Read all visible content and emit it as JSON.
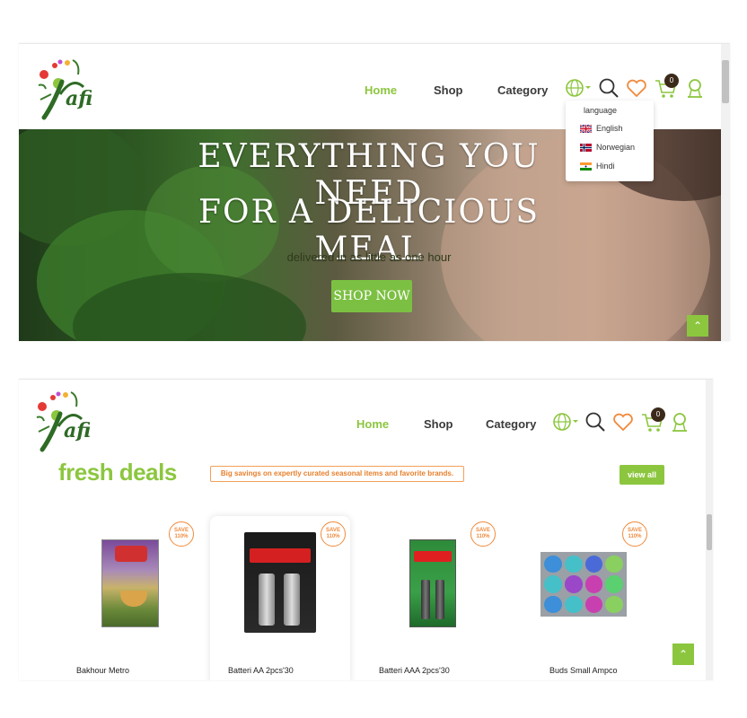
{
  "header": {
    "nav": [
      "Home",
      "Shop",
      "Category"
    ],
    "cart_count": "0"
  },
  "hero": {
    "title_line1": "EVERYTHING YOU NEED",
    "title_line2": "FOR A DELICIOUS MEAL",
    "subtitle": "delivered in as little as one hour",
    "cta": "SHOP NOW"
  },
  "language_menu": {
    "heading": "language",
    "options": [
      "English",
      "Norwegian",
      "Hindi"
    ]
  },
  "deals": {
    "title": "fresh deals",
    "tagline": "Big savings on expertly curated seasonal items and favorite brands.",
    "view_all": "view all",
    "save_label": "SAVE",
    "save_value": "110%",
    "products": [
      {
        "name": "Bakhour Metro"
      },
      {
        "name": "Batteri AA 2pcs'30"
      },
      {
        "name": "Batteri AAA 2pcs'30"
      },
      {
        "name": "Buds Small Ampco"
      }
    ]
  },
  "colors": {
    "accent": "#8cc63f",
    "orange": "#f08a3c"
  }
}
